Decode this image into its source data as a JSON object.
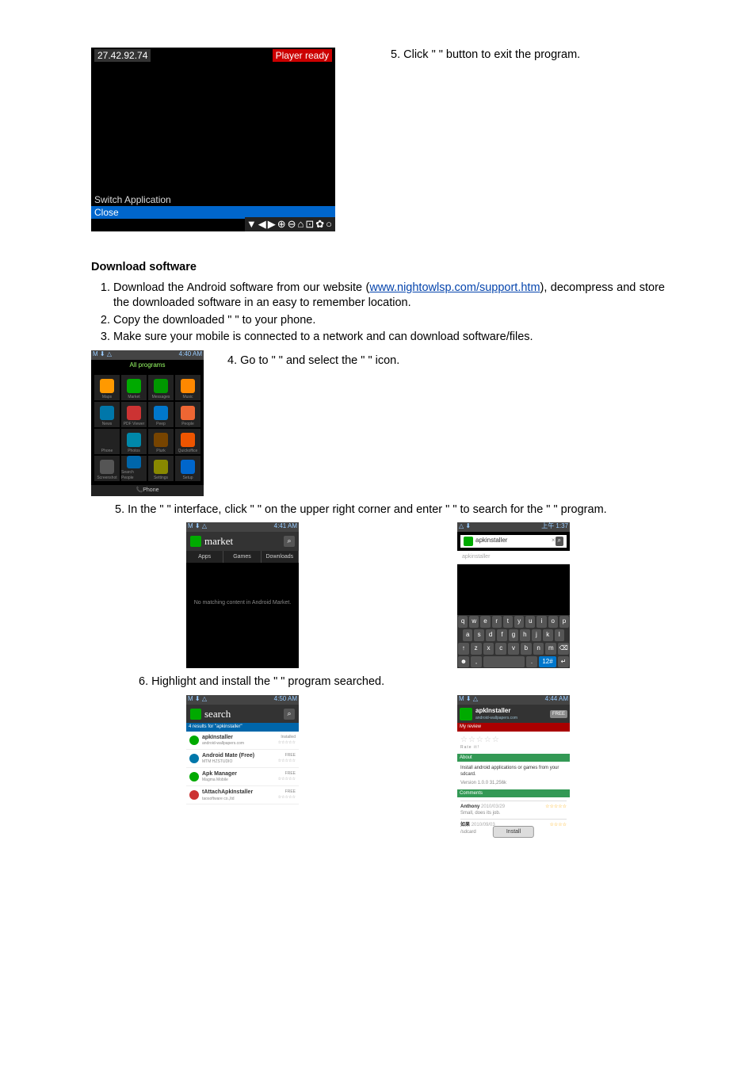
{
  "deviceBox": {
    "ip": "27.42.92.74",
    "status": "Player ready",
    "menu1": "Switch Application",
    "menu2": "Close",
    "iconStrip": "▼◀▶⊕⊖⌂⊡✿○"
  },
  "step5Top": "5. Click \"          \" button to exit the program.",
  "heading": "Download software",
  "listItems": [
    "Download the Android software from our website (www.nightowlsp.com/support.htm), decompress and store the downloaded software in an easy to remember location.",
    "Copy the downloaded \"              \" to your phone.",
    "Make sure your mobile is connected to a network and can download software/files."
  ],
  "link": "www.nightowlsp.com/support.htm",
  "listItem1a": "Download the Android software from our website (",
  "listItem1b": "), decompress and store the downloaded software in an easy to remember location.",
  "step4": "4. Go to \"                    \" and select the \"             \" icon.",
  "step5": "5. In the \"             \" interface, click \"          \" on the upper right corner and enter \"                     \" to search for the \"                       \" program.",
  "step6": "6. Highlight and install the \"                     \" program searched.",
  "thumbs": {
    "allPrograms": {
      "time": "4:40 AM",
      "header": "All programs",
      "apps": [
        "Maps",
        "Market",
        "Messages",
        "Music",
        "News",
        "PDF Viewer",
        "Peep",
        "People",
        "Phone",
        "Photos",
        "Plurk",
        "Quickoffice",
        "Screenshot",
        "Search People",
        "Settings",
        "Setup"
      ],
      "bottom": "Phone"
    },
    "market": {
      "time": "4:41 AM",
      "title": "market",
      "tabs": [
        "Apps",
        "Games",
        "Downloads"
      ],
      "empty": "No matching content in Android Market."
    },
    "kbSearch": {
      "time": "上午 1:37",
      "input": "apkinstaller",
      "clear": "×",
      "rows": [
        [
          "q",
          "w",
          "e",
          "r",
          "t",
          "y",
          "u",
          "i",
          "o",
          "p"
        ],
        [
          "a",
          "s",
          "d",
          "f",
          "g",
          "h",
          "j",
          "k",
          "l"
        ],
        [
          "↑",
          "z",
          "x",
          "c",
          "v",
          "b",
          "n",
          "m",
          "⌫"
        ]
      ]
    },
    "searchList": {
      "time": "4:50 AM",
      "title": "search",
      "items": [
        {
          "name": "apkInstaller",
          "sub": "android-wallpapers.com",
          "badge": "Installed"
        },
        {
          "name": "Android Mate (Free)",
          "sub": "MTM HZSTUDIO",
          "badge": "FREE"
        },
        {
          "name": "Apk Manager",
          "sub": "Magma Mobile",
          "badge": "FREE"
        },
        {
          "name": "tAttachApkInstaller",
          "sub": "taosoftware co.,ltd",
          "badge": "FREE"
        }
      ]
    },
    "detail": {
      "time": "4:44 AM",
      "title": "apkInstaller",
      "sub": "android-wallpapers.com",
      "price": "FREE",
      "rateLabel": "Rate it!",
      "redBar": "My review",
      "desc": "Install android applications or games from your sdcard.",
      "ver": "Version 1.0.0  31,256k",
      "greenBar": "Comments",
      "comments": [
        {
          "name": "Anthony",
          "date": "2010/03/29",
          "stars": "☆☆☆☆☆",
          "text": "Small, does its job."
        },
        {
          "name": "如果",
          "date": "2010/09/03",
          "stars": "☆☆☆☆",
          "text": "/sdcard"
        }
      ],
      "install": "Install"
    }
  }
}
